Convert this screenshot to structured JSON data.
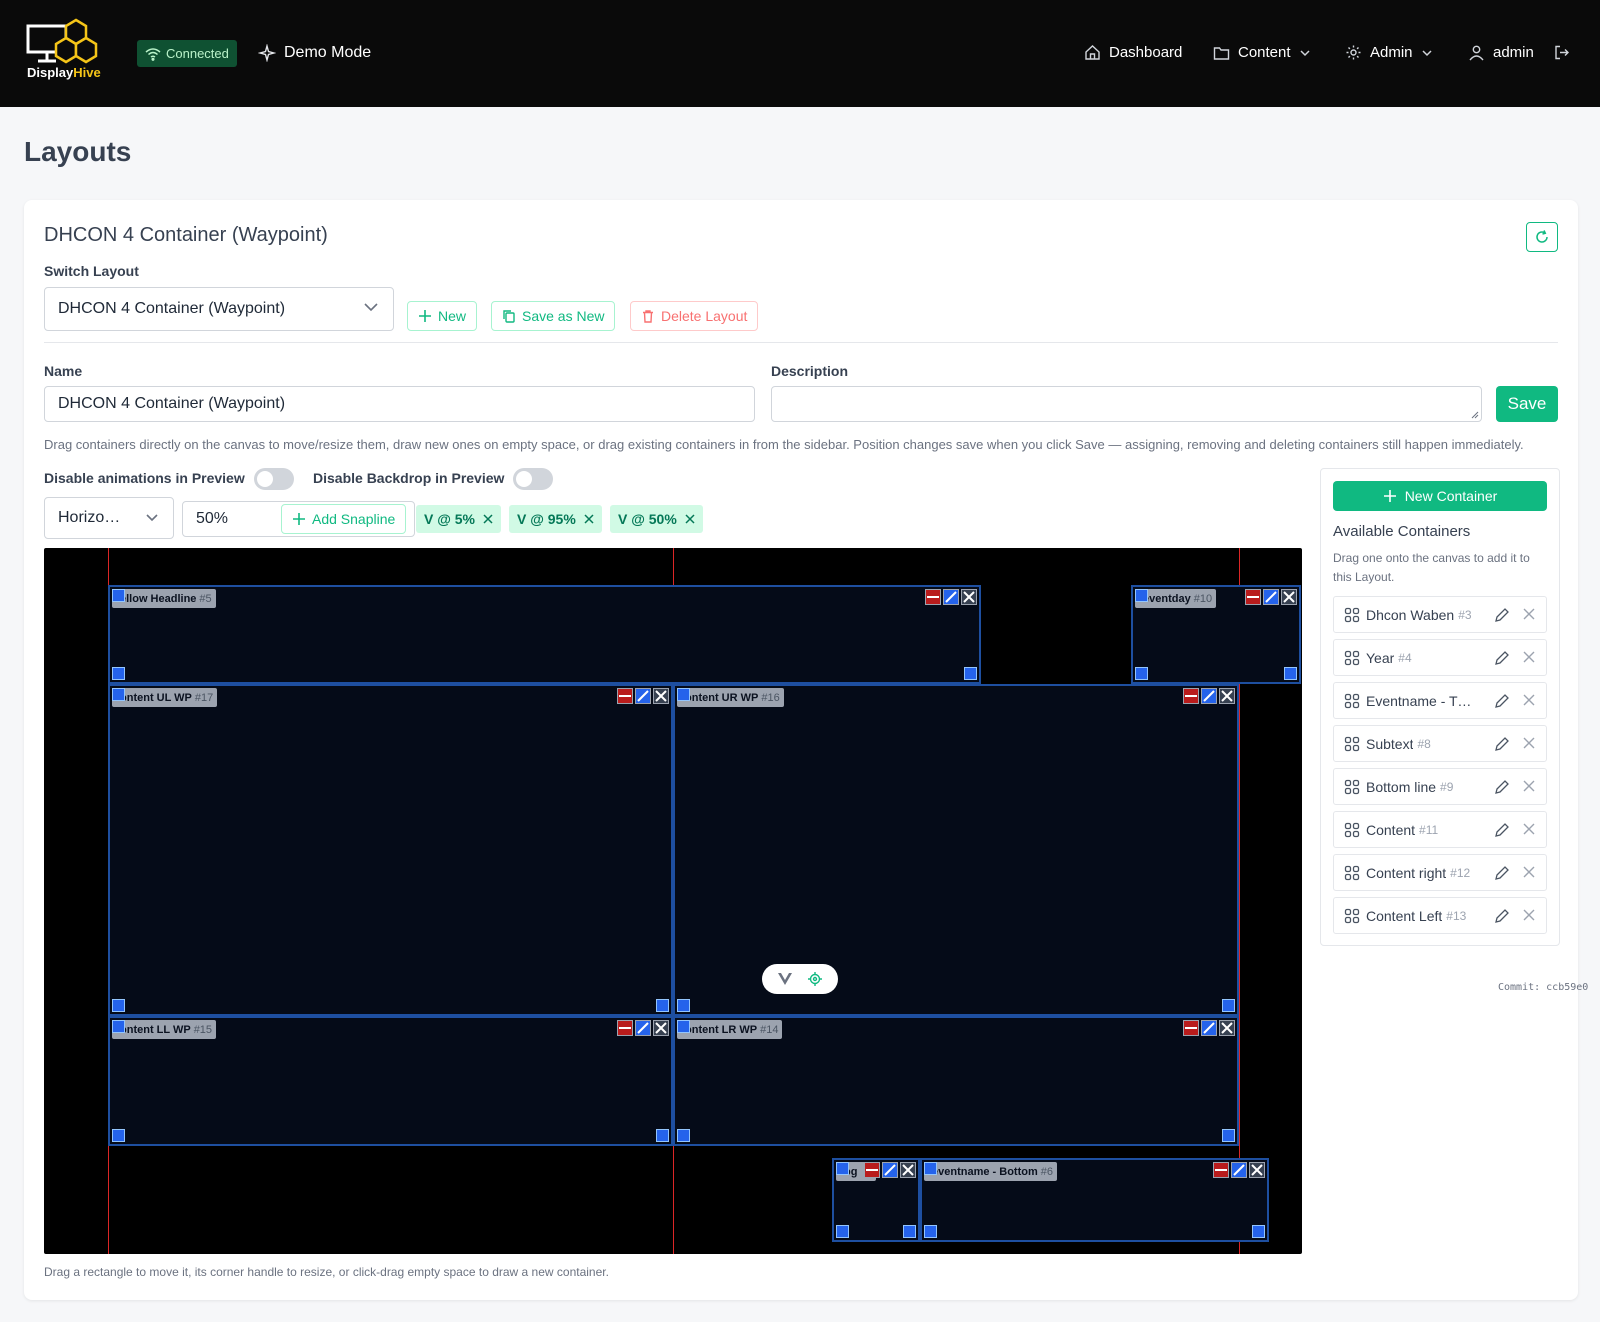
{
  "header": {
    "logo_display": "Display",
    "logo_hive": "Hive",
    "status": "Connected",
    "demo_mode": "Demo Mode",
    "nav": {
      "dashboard": "Dashboard",
      "content": "Content",
      "admin": "Admin",
      "user": "admin"
    }
  },
  "page": {
    "title": "Layouts",
    "layout_title": "DHCON 4 Container (Waypoint)",
    "switch_layout_label": "Switch Layout",
    "switch_layout_value": "DHCON 4 Container (Waypoint)",
    "new_button": "New",
    "save_as_new_button": "Save as New",
    "delete_layout_button": "Delete Layout",
    "name_label": "Name",
    "name_value": "DHCON 4 Container (Waypoint)",
    "description_label": "Description",
    "description_value": "",
    "save_button": "Save",
    "help_text": "Drag containers directly on the canvas to move/resize them, draw new ones on empty space, or drag existing containers in from the sidebar. Position changes save when you click Save — assigning, removing and deleting containers still happen immediately.",
    "disable_animations_label": "Disable animations in Preview",
    "disable_backdrop_label": "Disable Backdrop in Preview",
    "orientation_value": "Horizo…",
    "snap_value": "50%",
    "add_snapline_button": "Add Snapline",
    "snaplines": [
      "V @ 5%",
      "V @ 95%",
      "V @ 50%"
    ],
    "canvas_help": "Drag a rectangle to move it, its corner handle to resize, or click-drag empty space to draw a new container."
  },
  "canvas": {
    "containers": [
      {
        "label": "ellow Headline",
        "num": "#5"
      },
      {
        "label": "eventday",
        "num": "#10"
      },
      {
        "label": "ontent UL WP",
        "num": "#17"
      },
      {
        "label": "ontent UR WP",
        "num": "#16"
      },
      {
        "label": "ontent LL WP",
        "num": "#15"
      },
      {
        "label": "ontent LR WP",
        "num": "#14"
      },
      {
        "label": "og",
        "num": ""
      },
      {
        "label": "eventname - Bottom",
        "num": "#6"
      }
    ]
  },
  "sidebar": {
    "new_container_button": "New Container",
    "title": "Available Containers",
    "help": "Drag one onto the canvas to add it to this Layout.",
    "items": [
      {
        "name": "Dhcon Waben",
        "num": "#3"
      },
      {
        "name": "Year",
        "num": "#4"
      },
      {
        "name": "Eventname - TO…",
        "num": ""
      },
      {
        "name": "Subtext",
        "num": "#8"
      },
      {
        "name": "Bottom line",
        "num": "#9"
      },
      {
        "name": "Content",
        "num": "#11"
      },
      {
        "name": "Content right",
        "num": "#12"
      },
      {
        "name": "Content Left",
        "num": "#13"
      }
    ]
  },
  "footer": {
    "commit": "Commit: ccb59e0"
  },
  "colors": {
    "accent": "#10b981",
    "topbar": "#0a0a0a",
    "snapline": "#dc2626",
    "container_border": "#1e4fa0"
  }
}
